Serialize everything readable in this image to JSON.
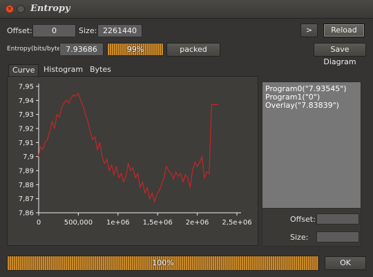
{
  "window": {
    "title": "Entropy"
  },
  "controls": {
    "offset_label": "Offset:",
    "offset_value": "0",
    "size_label": "Size:",
    "size_value": "2261440",
    "next_label": ">",
    "reload_label": "Reload",
    "entropy_label": "Entropy(bits/byte):",
    "entropy_value": "7.93686",
    "entropy_progress_text": "99%",
    "entropy_progress": 0.99,
    "classification": "packed",
    "save_diagram_label": "Save Diagram"
  },
  "tabs": [
    {
      "label": "Curve",
      "active": true
    },
    {
      "label": "Histogram",
      "active": false
    },
    {
      "label": "Bytes",
      "active": false
    }
  ],
  "regions": [
    "Program0(\"7.93545\")",
    "Program1(\"0\")",
    "Overlay(\"7.83839\")"
  ],
  "region_info": {
    "offset_label": "Offset:",
    "size_label": "Size:"
  },
  "footer": {
    "progress_text": "100%",
    "progress": 1.0,
    "ok_label": "OK"
  },
  "colors": {
    "curve": "#c8252a",
    "hatch_light": "#c98a2e",
    "hatch_dark": "#7a4d14"
  },
  "chart_data": {
    "type": "line",
    "xlim": [
      0,
      2500000
    ],
    "ylim": [
      7.86,
      7.95
    ],
    "x_ticks": [
      0,
      500000,
      1000000,
      1500000,
      2000000,
      2500000
    ],
    "x_tick_labels": [
      "0",
      "500,000",
      "1e+06",
      "1,5e+06",
      "2e+06",
      "2,5e+06"
    ],
    "y_ticks": [
      7.86,
      7.87,
      7.88,
      7.89,
      7.9,
      7.91,
      7.92,
      7.93,
      7.94,
      7.95
    ],
    "y_tick_labels": [
      "7,86",
      "7,87",
      "7,88",
      "7,89",
      "7,9",
      "7,91",
      "7,92",
      "7,93",
      "7,94",
      "7,95"
    ],
    "grid": false,
    "x": [
      0,
      20000,
      50000,
      80000,
      110000,
      140000,
      170000,
      200000,
      230000,
      260000,
      290000,
      320000,
      350000,
      380000,
      410000,
      440000,
      470000,
      500000,
      530000,
      560000,
      590000,
      620000,
      650000,
      680000,
      710000,
      740000,
      770000,
      800000,
      830000,
      860000,
      890000,
      920000,
      950000,
      980000,
      1010000,
      1040000,
      1070000,
      1100000,
      1130000,
      1160000,
      1190000,
      1220000,
      1250000,
      1280000,
      1310000,
      1340000,
      1370000,
      1400000,
      1430000,
      1460000,
      1490000,
      1520000,
      1550000,
      1580000,
      1610000,
      1640000,
      1670000,
      1700000,
      1730000,
      1760000,
      1790000,
      1820000,
      1850000,
      1880000,
      1910000,
      1940000,
      1970000,
      2000000,
      2030000,
      2060000,
      2090000,
      2120000,
      2150000,
      2180000,
      2210000,
      2240000,
      2261440
    ],
    "values": [
      7.9,
      7.907,
      7.905,
      7.91,
      7.912,
      7.918,
      7.925,
      7.92,
      7.93,
      7.928,
      7.935,
      7.938,
      7.94,
      7.938,
      7.942,
      7.944,
      7.943,
      7.945,
      7.94,
      7.936,
      7.93,
      7.925,
      7.918,
      7.912,
      7.914,
      7.905,
      7.91,
      7.9,
      7.895,
      7.898,
      7.89,
      7.894,
      7.887,
      7.893,
      7.885,
      7.888,
      7.882,
      7.886,
      7.895,
      7.89,
      7.892,
      7.885,
      7.888,
      7.878,
      7.882,
      7.874,
      7.878,
      7.87,
      7.874,
      7.868,
      7.873,
      7.876,
      7.88,
      7.885,
      7.893,
      7.89,
      7.888,
      7.884,
      7.889,
      7.886,
      7.888,
      7.882,
      7.887,
      7.885,
      7.878,
      7.89,
      7.896,
      7.893,
      7.896,
      7.9,
      7.885,
      7.889,
      7.888,
      7.937,
      7.937,
      7.937,
      7.937
    ]
  }
}
